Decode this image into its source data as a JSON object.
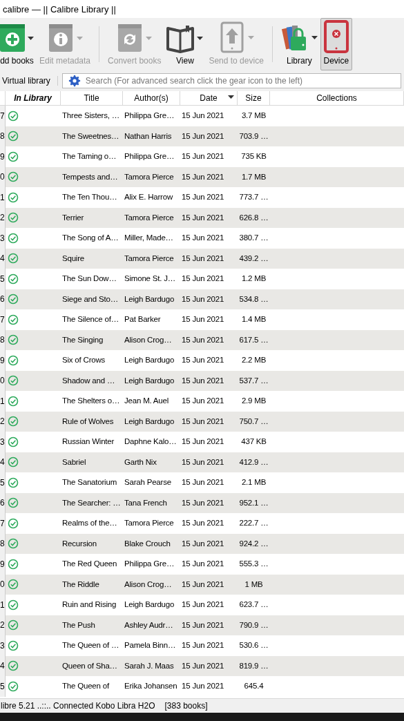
{
  "window": {
    "title": "calibre — || Calibre Library ||"
  },
  "toolbar": [
    {
      "label": "dd books",
      "kind": "add",
      "disabled": false,
      "selected": false,
      "dropdown": true
    },
    {
      "label": "Edit metadata",
      "kind": "info",
      "disabled": true,
      "selected": false,
      "dropdown": true,
      "separator_after": true
    },
    {
      "label": "Convert books",
      "kind": "convert",
      "disabled": true,
      "selected": false,
      "dropdown": true
    },
    {
      "label": "View",
      "kind": "view",
      "disabled": false,
      "selected": false,
      "dropdown": true
    },
    {
      "label": "Send to device",
      "kind": "send",
      "disabled": true,
      "selected": false,
      "dropdown": true,
      "separator_after": true
    },
    {
      "label": "Library",
      "kind": "library",
      "disabled": false,
      "selected": false,
      "dropdown": true
    },
    {
      "label": "Device",
      "kind": "device",
      "disabled": false,
      "selected": true,
      "dropdown": false
    }
  ],
  "virtual_library": {
    "label": "Virtual library"
  },
  "search": {
    "placeholder": "Search (For advanced search click the gear icon to the left)"
  },
  "table": {
    "columns": [
      {
        "label": "In Library",
        "sorted": false
      },
      {
        "label": "Title",
        "sorted": false
      },
      {
        "label": "Author(s)",
        "sorted": false
      },
      {
        "label": "Date",
        "sorted": true
      },
      {
        "label": "Size",
        "sorted": false
      },
      {
        "label": "Collections",
        "sorted": false
      }
    ],
    "rows": [
      {
        "num": "7",
        "in_library": true,
        "title": "Three Sisters, …",
        "author": "Philippa Gre…",
        "date": "15 Jun 2021",
        "size": "3.7 MB"
      },
      {
        "num": "8",
        "in_library": true,
        "title": "The Sweetnes…",
        "author": "Nathan Harris",
        "date": "15 Jun 2021",
        "size": "703.9 …"
      },
      {
        "num": "9",
        "in_library": true,
        "title": "The Taming o…",
        "author": "Philippa Gre…",
        "date": "15 Jun 2021",
        "size": "735 KB"
      },
      {
        "num": "0",
        "in_library": true,
        "title": "Tempests and…",
        "author": "Tamora Pierce",
        "date": "15 Jun 2021",
        "size": "1.7 MB"
      },
      {
        "num": "1",
        "in_library": true,
        "title": "The Ten Thou…",
        "author": "Alix E. Harrow",
        "date": "15 Jun 2021",
        "size": "773.7 …"
      },
      {
        "num": "2",
        "in_library": true,
        "title": "Terrier",
        "author": "Tamora Pierce",
        "date": "15 Jun 2021",
        "size": "626.8 …"
      },
      {
        "num": "3",
        "in_library": true,
        "title": "The Song of A…",
        "author": "Miller, Made…",
        "date": "15 Jun 2021",
        "size": "380.7 …"
      },
      {
        "num": "4",
        "in_library": true,
        "title": "Squire",
        "author": "Tamora Pierce",
        "date": "15 Jun 2021",
        "size": "439.2 …"
      },
      {
        "num": "5",
        "in_library": true,
        "title": "The Sun Dow…",
        "author": "Simone St. J…",
        "date": "15 Jun 2021",
        "size": "1.2 MB"
      },
      {
        "num": "6",
        "in_library": true,
        "title": "Siege and Sto…",
        "author": "Leigh Bardugo",
        "date": "15 Jun 2021",
        "size": "534.8 …"
      },
      {
        "num": "7",
        "in_library": true,
        "title": "The Silence of…",
        "author": "Pat Barker",
        "date": "15 Jun 2021",
        "size": "1.4 MB"
      },
      {
        "num": "8",
        "in_library": true,
        "title": "The Singing",
        "author": "Alison Crog…",
        "date": "15 Jun 2021",
        "size": "617.5 …"
      },
      {
        "num": "9",
        "in_library": true,
        "title": "Six of Crows",
        "author": "Leigh Bardugo",
        "date": "15 Jun 2021",
        "size": "2.2 MB"
      },
      {
        "num": "0",
        "in_library": true,
        "title": "Shadow and …",
        "author": "Leigh Bardugo",
        "date": "15 Jun 2021",
        "size": "537.7 …"
      },
      {
        "num": "1",
        "in_library": true,
        "title": "The Shelters o…",
        "author": "Jean M. Auel",
        "date": "15 Jun 2021",
        "size": "2.9 MB"
      },
      {
        "num": "2",
        "in_library": true,
        "title": "Rule of Wolves",
        "author": "Leigh Bardugo",
        "date": "15 Jun 2021",
        "size": "750.7 …"
      },
      {
        "num": "3",
        "in_library": true,
        "title": "Russian Winter",
        "author": "Daphne Kalo…",
        "date": "15 Jun 2021",
        "size": "437 KB"
      },
      {
        "num": "4",
        "in_library": true,
        "title": "Sabriel",
        "author": "Garth Nix",
        "date": "15 Jun 2021",
        "size": "412.9 …"
      },
      {
        "num": "5",
        "in_library": true,
        "title": "The Sanatorium",
        "author": "Sarah Pearse",
        "date": "15 Jun 2021",
        "size": "2.1 MB"
      },
      {
        "num": "6",
        "in_library": true,
        "title": "The Searcher: …",
        "author": "Tana French",
        "date": "15 Jun 2021",
        "size": "952.1 …"
      },
      {
        "num": "7",
        "in_library": true,
        "title": "Realms of the…",
        "author": "Tamora Pierce",
        "date": "15 Jun 2021",
        "size": "222.7 …"
      },
      {
        "num": "8",
        "in_library": true,
        "title": "Recursion",
        "author": "Blake Crouch",
        "date": "15 Jun 2021",
        "size": "924.2 …"
      },
      {
        "num": "9",
        "in_library": true,
        "title": "The Red Queen",
        "author": "Philippa Gre…",
        "date": "15 Jun 2021",
        "size": "555.3 …"
      },
      {
        "num": "0",
        "in_library": true,
        "title": "The Riddle",
        "author": "Alison Crog…",
        "date": "15 Jun 2021",
        "size": "1 MB"
      },
      {
        "num": "1",
        "in_library": true,
        "title": "Ruin and Rising",
        "author": "Leigh Bardugo",
        "date": "15 Jun 2021",
        "size": "623.7 …"
      },
      {
        "num": "2",
        "in_library": true,
        "title": "The Push",
        "author": "Ashley Audr…",
        "date": "15 Jun 2021",
        "size": "790.9 …"
      },
      {
        "num": "3",
        "in_library": true,
        "title": "The Queen of …",
        "author": "Pamela Binn…",
        "date": "15 Jun 2021",
        "size": "530.6 …"
      },
      {
        "num": "4",
        "in_library": true,
        "title": "Queen of Sha…",
        "author": "Sarah J. Maas",
        "date": "15 Jun 2021",
        "size": "819.9 …"
      },
      {
        "num": "5",
        "in_library": true,
        "title": "The Queen of",
        "author": "Erika Johansen",
        "date": "15 Jun 2021",
        "size": "645.4"
      }
    ]
  },
  "status_bar": {
    "text": "libre 5.21 ..::.. Connected Kobo Libra H2O",
    "count": "[383 books]"
  }
}
